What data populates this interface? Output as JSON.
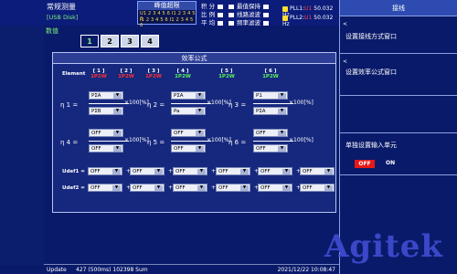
{
  "header": {
    "mode_title": "常规测量",
    "mode_sub": "[USB Disk]",
    "peak": {
      "title": "峰值超限",
      "row1": "U1 2 3 4 5 6 I1 2 3 4 5 6",
      "row2": "I1 2 3 4 5 6 I1 2 3 4 5 6"
    },
    "stats": [
      {
        "label": "积  分"
      },
      {
        "label": "比  例"
      },
      {
        "label": "平  均"
      }
    ],
    "holds": [
      {
        "label": "最值保持"
      },
      {
        "label": "线路滤波"
      },
      {
        "label": "频率滤波"
      }
    ],
    "pll1": {
      "label": "PLL1:",
      "source": "U1",
      "value": "50.032 Hz"
    },
    "pll2": {
      "label": "PLL2:",
      "source": "U1",
      "value": "50.032 Hz"
    }
  },
  "numeric_label": "数值",
  "page_tabs": [
    "1",
    "2",
    "3",
    "4"
  ],
  "dialog": {
    "title": "效率公式",
    "element_label": "Element",
    "columns": [
      {
        "num": "[ 1 ]",
        "wiring": "1P2W",
        "color": "red"
      },
      {
        "num": "[ 2 ]",
        "wiring": "1P2W",
        "color": "red"
      },
      {
        "num": "[ 3 ]",
        "wiring": "1P2W",
        "color": "red"
      },
      {
        "num": "[ 4 ]",
        "wiring": "1P2W",
        "color": "green"
      },
      {
        "num": "[ 5 ]",
        "wiring": "1P2W",
        "color": "green"
      },
      {
        "num": "[ 6 ]",
        "wiring": "1P2W",
        "color": "green"
      }
    ],
    "times100": "×100[%]",
    "eta": [
      {
        "label": "η 1 =",
        "num": "PΣA",
        "den": "PΣB"
      },
      {
        "label": "η 2 =",
        "num": "PΣA",
        "den": "Pa"
      },
      {
        "label": "η 3 =",
        "num": "P1",
        "den": "PΣA"
      },
      {
        "label": "η 4 =",
        "num": "OFF",
        "den": "OFF"
      },
      {
        "label": "η 5 =",
        "num": "OFF",
        "den": "OFF"
      },
      {
        "label": "η 6 =",
        "num": "OFF",
        "den": "OFF"
      }
    ],
    "udef": [
      {
        "label": "Udef1 =",
        "values": [
          "OFF",
          "OFF",
          "OFF",
          "OFF",
          "OFF",
          "OFF"
        ]
      },
      {
        "label": "Udef2 =",
        "values": [
          "OFF",
          "OFF",
          "OFF",
          "OFF",
          "OFF",
          "OFF"
        ]
      }
    ],
    "plus": "+"
  },
  "status": {
    "update": "Update",
    "info": "427 (500ms)  102398 Sum",
    "time": "2021/12/22   10:08:47"
  },
  "right_menu": {
    "title": "接线",
    "items": [
      {
        "label": "设置接线方式窗口"
      },
      {
        "label": "设置效率公式窗口"
      },
      {
        "label": ""
      },
      {
        "label": "单独设置输入单元"
      }
    ],
    "toggle_off": "OFF",
    "toggle_on": "ON"
  },
  "logo": "Agitek"
}
